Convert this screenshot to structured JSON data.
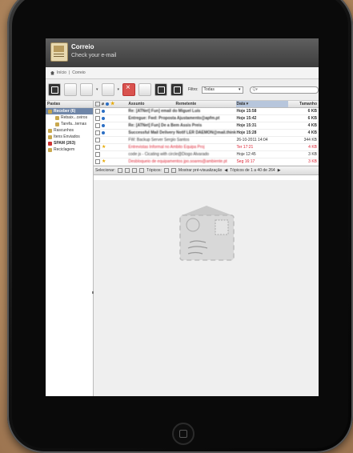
{
  "app": {
    "title": "Correio",
    "subtitle": "Check your e-mail"
  },
  "breadcrumb": {
    "home": "Início",
    "separator": "|",
    "current": "Correio"
  },
  "toolbar": {
    "filter_label": "Filtro:",
    "filter_value": "Todas",
    "search_placeholder": "Q▾"
  },
  "sidebar": {
    "header": "Pastas",
    "items": [
      {
        "label": "Receber (6)",
        "selected": true,
        "icon": "inbox-icon"
      },
      {
        "label": "Rebaix...ceiros",
        "sub": true,
        "icon": "folder-icon"
      },
      {
        "label": "Tarefa...ternas",
        "sub": true,
        "icon": "folder-icon"
      },
      {
        "label": "Rascunhos",
        "icon": "drafts-icon"
      },
      {
        "label": "Itens Enviados",
        "icon": "sent-icon"
      },
      {
        "label": "SPAM (263)",
        "icon": "spam-icon"
      },
      {
        "label": "Reciclagem",
        "icon": "trash-icon"
      }
    ]
  },
  "list": {
    "columns": {
      "subject": "Assunto",
      "sender": "Remetente",
      "date": "Data",
      "size": "Tamanho"
    },
    "rows": [
      {
        "subject": "Re: [ATNet] Fun] email do Miguel Luís",
        "date": "Hoje 15:58",
        "size": "6 KB",
        "unread": true
      },
      {
        "subject": "Entregue: Fwd: Proposta Ajustamento@apfm.pt",
        "date": "Hoje 15:42",
        "size": "6 KB",
        "unread": true
      },
      {
        "subject": "Re: [ATNet] Fun] De a Bem Assis Preis",
        "date": "Hoje 15:31",
        "size": "4 KB",
        "unread": true
      },
      {
        "subject": "Successful Mail Delivery Notif LER DAEMON@mail.thinktip",
        "date": "Hoje 15:28",
        "size": "4 KB",
        "unread": true
      },
      {
        "subject": "FW: Backup Server        Sergio Santos",
        "date": "26-10-2011 14:04",
        "size": "344 KB",
        "unread": false
      },
      {
        "subject": "Entrevistas Informal no Ambito Equipa Proj",
        "date": "Ter 17:21",
        "size": "4 KB",
        "unread": false,
        "red": true
      },
      {
        "subject": "code js - Cicating with circle@Diogo Alvarado",
        "date": "Hoje 12:45",
        "size": "3 KB",
        "unread": false
      },
      {
        "subject": "Desbloqueio de equipamentos jpo.soares@ambiente.pt",
        "date": "Seg 16:17",
        "size": "3 KB",
        "unread": false,
        "red": true
      }
    ]
  },
  "status": {
    "select": "Selecionar:",
    "threads": "Tópicos:",
    "preview": "Mostrar pré-visualização",
    "paging": "Tópicos de 1 a 40 de 264"
  },
  "colors": {
    "header_bg": "#4b4b4b",
    "selection": "#6f86a8",
    "unread_dot": "#2a6ec4",
    "highlight_red": "#dd2233"
  }
}
